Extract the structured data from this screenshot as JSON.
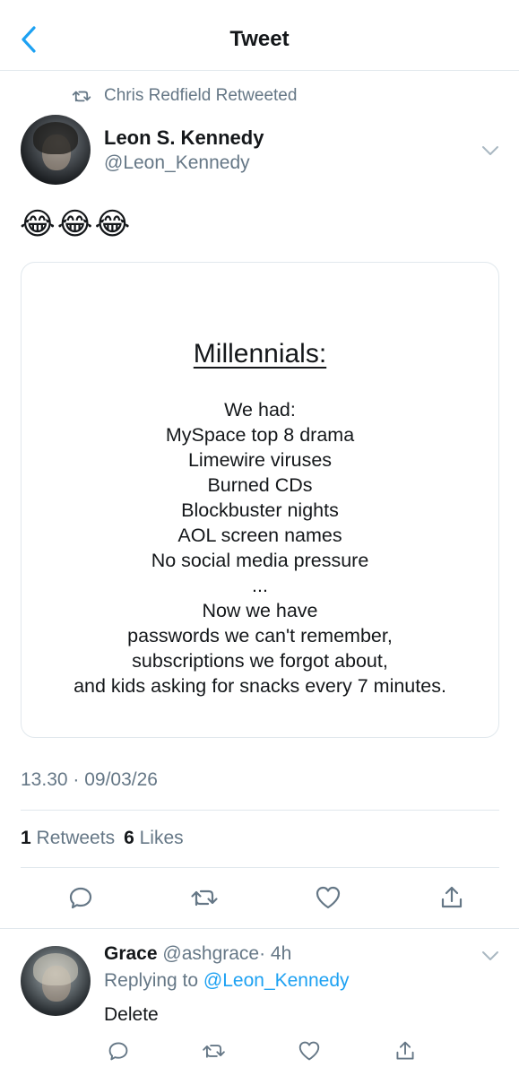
{
  "header": {
    "title": "Tweet"
  },
  "retweet_notice": {
    "text": "Chris Redfield Retweeted"
  },
  "tweet": {
    "author_name": "Leon S. Kennedy",
    "author_handle": "@Leon_Kennedy",
    "text": "😂😂😂",
    "meme": {
      "heading": "Millennials:",
      "lines": [
        "We had:",
        "MySpace top 8 drama",
        "Limewire viruses",
        "Burned CDs",
        "Blockbuster nights",
        "AOL screen names",
        "No social media pressure",
        "...",
        "Now we have",
        "passwords we can't remember,",
        "subscriptions we forgot about,",
        "and kids asking for snacks every 7 minutes."
      ]
    },
    "timestamp": "13.30 · 09/03/26",
    "retweets_count": "1",
    "retweets_label": "Retweets",
    "likes_count": "6",
    "likes_label": "Likes"
  },
  "reply": {
    "author_name": "Grace",
    "author_handle": "@ashgrace",
    "age": "· 4h",
    "replying_prefix": "Replying to",
    "replying_handle": "@Leon_Kennedy",
    "text": "Delete"
  },
  "colors": {
    "accent": "#1da1f2",
    "muted": "#657786",
    "border": "#e1e8ed",
    "text": "#14171a"
  }
}
